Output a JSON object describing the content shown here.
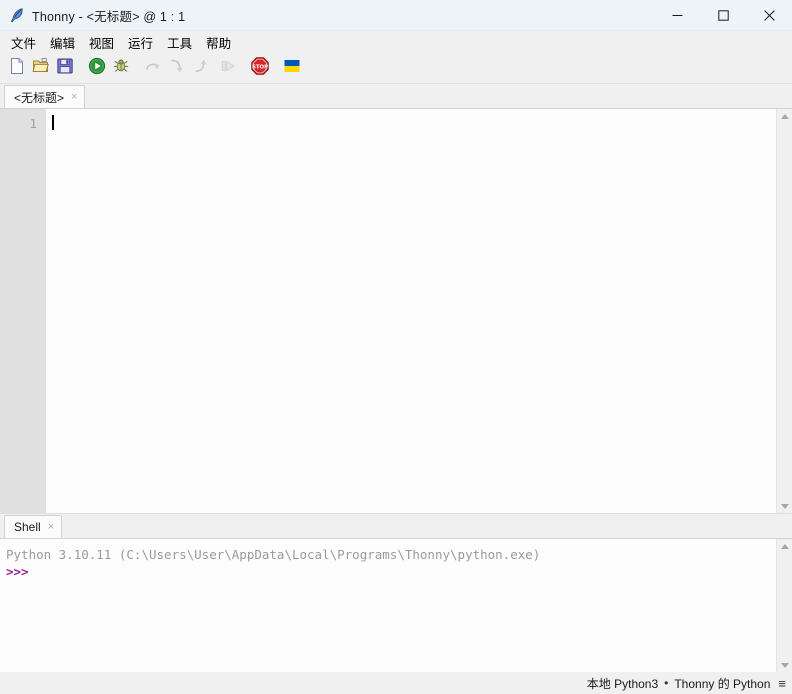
{
  "window": {
    "app_name": "Thonny",
    "title": "Thonny - <无标题> @ 1 : 1",
    "icon": "feather-icon",
    "controls": {
      "minimize": "minimize-icon",
      "maximize": "maximize-icon",
      "close": "close-icon"
    }
  },
  "menubar": {
    "items": [
      {
        "label": "文件"
      },
      {
        "label": "编辑"
      },
      {
        "label": "视图"
      },
      {
        "label": "运行"
      },
      {
        "label": "工具"
      },
      {
        "label": "帮助"
      }
    ]
  },
  "toolbar": {
    "buttons": [
      {
        "name": "new-file-button",
        "icon": "new-file-icon",
        "enabled": true
      },
      {
        "name": "open-file-button",
        "icon": "open-folder-icon",
        "enabled": true
      },
      {
        "name": "save-file-button",
        "icon": "floppy-disk-icon",
        "enabled": true
      },
      {
        "name": "run-button",
        "icon": "green-play-icon",
        "enabled": true
      },
      {
        "name": "debug-button",
        "icon": "bug-icon",
        "enabled": true
      },
      {
        "name": "step-over-button",
        "icon": "step-over-icon",
        "enabled": false
      },
      {
        "name": "step-into-button",
        "icon": "step-into-icon",
        "enabled": false
      },
      {
        "name": "step-out-button",
        "icon": "step-out-icon",
        "enabled": false
      },
      {
        "name": "resume-button",
        "icon": "resume-icon",
        "enabled": false
      },
      {
        "name": "stop-button",
        "icon": "stop-sign-icon",
        "enabled": true
      },
      {
        "name": "ukraine-flag-button",
        "icon": "ukraine-flag-icon",
        "enabled": true
      }
    ]
  },
  "editor": {
    "tab": {
      "label": "<无标题>",
      "close": "×"
    },
    "line_numbers": [
      "1"
    ],
    "content": "",
    "cursor_position": "1 : 1"
  },
  "shell": {
    "tab": {
      "label": "Shell",
      "close": "×"
    },
    "banner": "Python 3.10.11 (C:\\Users\\User\\AppData\\Local\\Programs\\Thonny\\python.exe)",
    "prompt": ">>>",
    "input": ""
  },
  "statusbar": {
    "interpreter": "本地 Python3",
    "separator": "•",
    "backend": "Thonny 的 Python",
    "menu_icon": "≡"
  },
  "colors": {
    "titlebar_bg": "#eef3f7",
    "chrome_bg": "#f0f0f0",
    "editor_bg": "#fdfdfd",
    "gutter_bg": "#e0e0e0",
    "gutter_fg": "#a0a0a0",
    "shell_banner_fg": "#9a9a9a",
    "shell_prompt_fg": "#9b1f8e",
    "run_green": "#2e9e3e",
    "stop_red": "#cc2127",
    "flag_blue": "#0057b7",
    "flag_yellow": "#ffd700"
  }
}
